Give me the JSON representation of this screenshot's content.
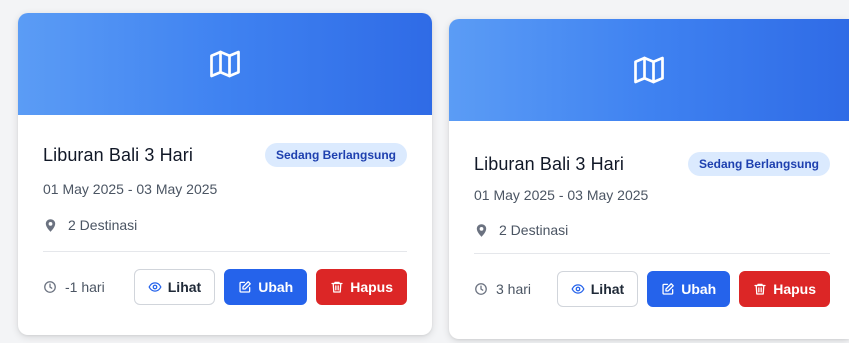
{
  "cards": [
    {
      "title": "Liburan Bali 3 Hari",
      "status": "Sedang Berlangsung",
      "dates": "01 May 2025 - 03 May 2025",
      "destinations": "2 Destinasi",
      "duration": "-1 hari",
      "view_label": "Lihat",
      "edit_label": "Ubah",
      "delete_label": "Hapus"
    },
    {
      "title": "Liburan Bali 3 Hari",
      "status": "Sedang Berlangsung",
      "dates": "01 May 2025 - 03 May 2025",
      "destinations": "2 Destinasi",
      "duration": "3 hari",
      "view_label": "Lihat",
      "edit_label": "Ubah",
      "delete_label": "Hapus"
    }
  ],
  "icons": {
    "banner": "map-icon",
    "destinations": "map-pin-icon",
    "duration": "clock-icon",
    "view": "eye-icon",
    "edit": "edit-icon",
    "delete": "trash-icon"
  },
  "colors": {
    "banner_start": "#5b9cf5",
    "banner_end": "#2f6be6",
    "badge_bg": "#dbeafe",
    "badge_text": "#1e40af",
    "edit": "#2563eb",
    "delete": "#dc2626"
  }
}
